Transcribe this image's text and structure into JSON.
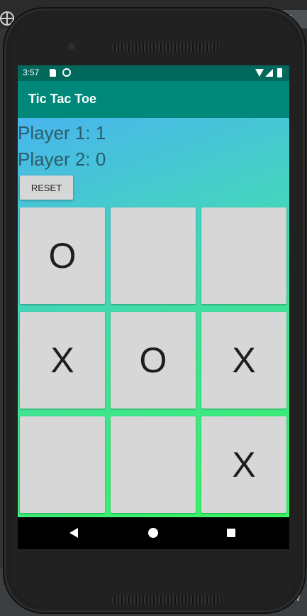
{
  "ide": {
    "tab_fragment": "g",
    "bottom_fragment": "w"
  },
  "status_bar": {
    "time": "3:57"
  },
  "app": {
    "title": "Tic Tac Toe"
  },
  "scores": {
    "player1": "Player 1: 1",
    "player2": "Player 2: 0"
  },
  "controls": {
    "reset_label": "RESET"
  },
  "board": {
    "cells": [
      "O",
      "",
      "",
      "X",
      "O",
      "X",
      "",
      "",
      "X"
    ]
  },
  "colors": {
    "status_bar": "#00695c",
    "app_bar": "#00897b",
    "gradient_start": "#49b5ee",
    "gradient_end": "#39f55f",
    "score_text": "#2b5d6a",
    "cell_background": "#d7d7d7"
  }
}
